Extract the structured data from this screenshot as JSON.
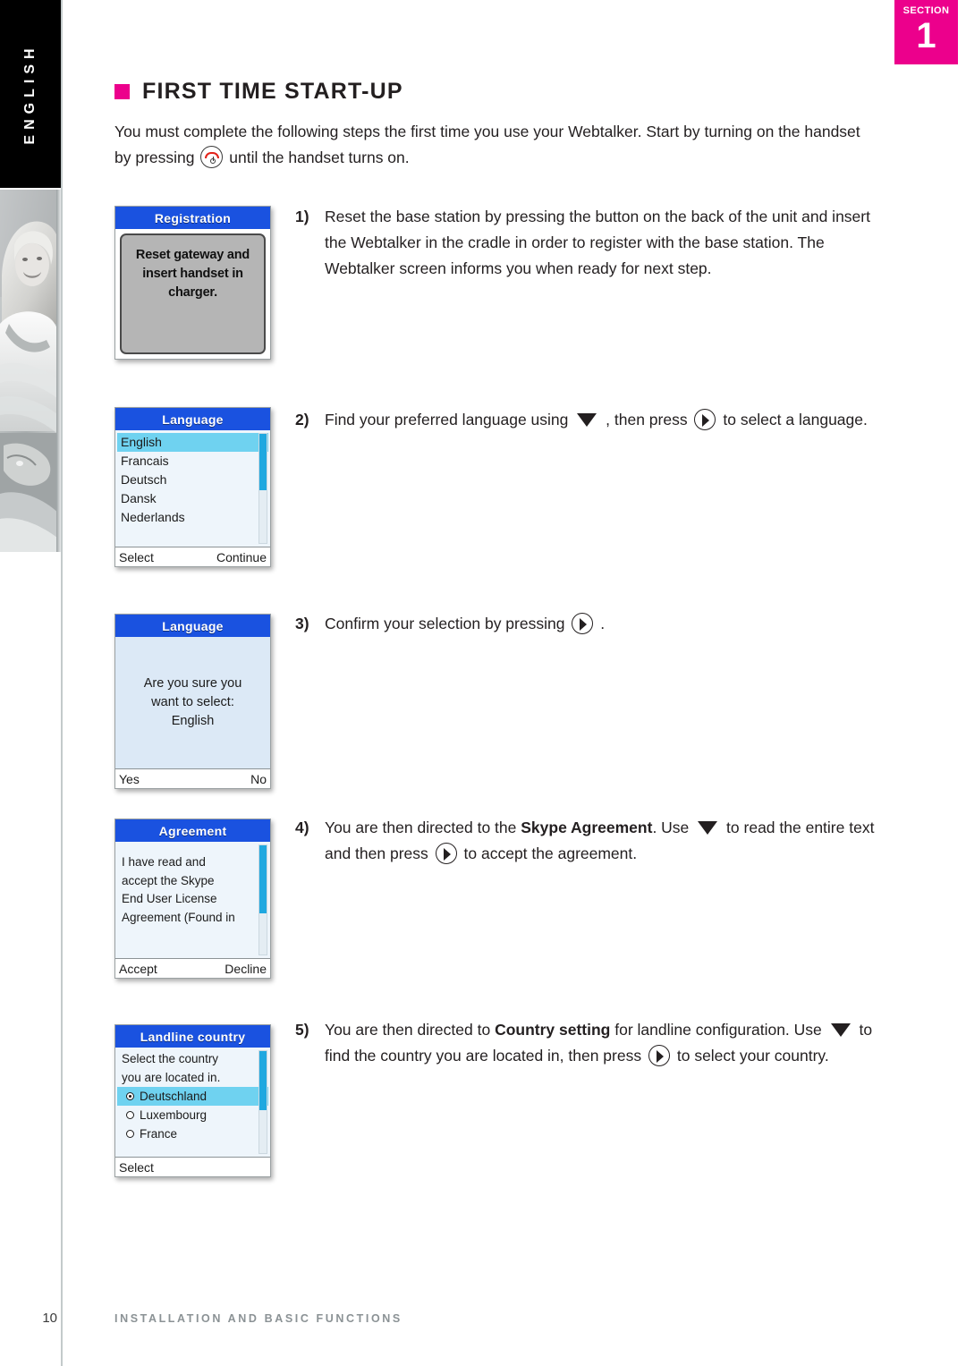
{
  "sidebar": {
    "language_tab": "ENGLISH",
    "photo_alt": "woman-photo"
  },
  "section_badge": {
    "label": "SECTION",
    "number": "1",
    "color": "#ec008c"
  },
  "page": {
    "title": "FIRST TIME START-UP",
    "intro_part1": "You must complete the following steps the first time you use your Webtalker. Start by turning on the handset by pressing",
    "intro_part2": "until the handset turns on."
  },
  "steps": [
    {
      "number": "1)",
      "text": "Reset the base station by pressing the button on the back of the unit and insert the Webtalker in the cradle in order to register with the base station. The Webtalker screen informs you when ready for next step."
    },
    {
      "number": "2)",
      "part1": "Find your preferred language using",
      "part2": ", then press",
      "part3": "to select a language."
    },
    {
      "number": "3)",
      "part1": "Confirm your selection by pressing",
      "part2": "."
    },
    {
      "number": "4)",
      "part1": "You are then directed to the",
      "bold1": "Skype Agreement",
      "part2": ". Use",
      "part3": "to read the entire text and then press",
      "part4": "to accept the agreement."
    },
    {
      "number": "5)",
      "part1": "You are then directed to",
      "bold1": "Country setting",
      "part2": "for landline configuration. Use",
      "part3": "to find the country you are located in, then press",
      "part4": "to select your country."
    }
  ],
  "screens": {
    "registration": {
      "title": "Registration",
      "message": "Reset gateway and insert handset in charger."
    },
    "language_list": {
      "title": "Language",
      "items": [
        "English",
        "Francais",
        "Deutsch",
        "Dansk",
        "Nederlands"
      ],
      "selected": "English",
      "footer_left": "Select",
      "footer_right": "Continue"
    },
    "language_confirm": {
      "title": "Language",
      "line1": "Are you sure you",
      "line2": "want to select:",
      "line3": "English",
      "footer_left": "Yes",
      "footer_right": "No"
    },
    "agreement": {
      "title": "Agreement",
      "lines": [
        "I have read and",
        "accept the Skype",
        "End User License",
        "Agreement (Found in"
      ],
      "footer_left": "Accept",
      "footer_right": "Decline"
    },
    "landline_country": {
      "title": "Landline country",
      "prompt_line1": "Select the country",
      "prompt_line2": "you are located in.",
      "options": [
        "Deutschland",
        "Luxembourg",
        "France"
      ],
      "selected": "Deutschland",
      "footer_left": "Select",
      "footer_right": ""
    }
  },
  "footer": {
    "page_number": "10",
    "text": "INSTALLATION AND BASIC FUNCTIONS"
  }
}
